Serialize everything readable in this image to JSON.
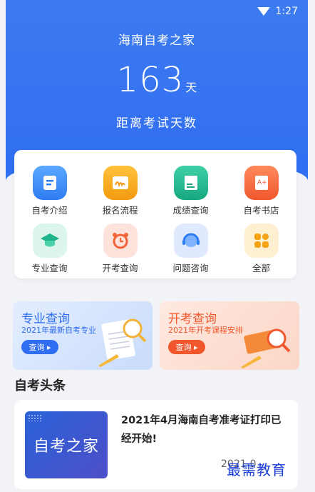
{
  "status": {
    "time": "1:27"
  },
  "hero": {
    "title": "海南自考之家",
    "days_number": "163",
    "days_unit": "天",
    "days_label": "距离考试天数"
  },
  "menu": [
    {
      "label": "自考介绍",
      "icon": "document-icon",
      "color": "#2f86f2"
    },
    {
      "label": "报名流程",
      "icon": "signup-icon",
      "color": "#f5a417"
    },
    {
      "label": "成绩查询",
      "icon": "scorecard-icon",
      "color": "#1fb38a"
    },
    {
      "label": "自考书店",
      "icon": "book-store-icon",
      "color": "#f2633a"
    },
    {
      "label": "专业查询",
      "icon": "graduation-cap-icon",
      "color": "#1fb38a"
    },
    {
      "label": "开考查询",
      "icon": "alarm-clock-icon",
      "color": "#f2633a"
    },
    {
      "label": "问题咨询",
      "icon": "headset-icon",
      "color": "#2f86f2"
    },
    {
      "label": "全部",
      "icon": "grid-icon",
      "color": "#f5a417"
    }
  ],
  "banners": [
    {
      "title": "专业查询",
      "subtitle": "2021年最新自考专业",
      "button": "查询 ▸"
    },
    {
      "title": "开考查询",
      "subtitle": "2021年开考课程安排",
      "button": "查询 ▸"
    }
  ],
  "news_section": {
    "title": "自考头条"
  },
  "news": [
    {
      "thumb_text": "自考之家",
      "title": "2021年4月海南自考准考证打印已经开始!",
      "date": "2021-0"
    }
  ],
  "watermark": "最需教育"
}
